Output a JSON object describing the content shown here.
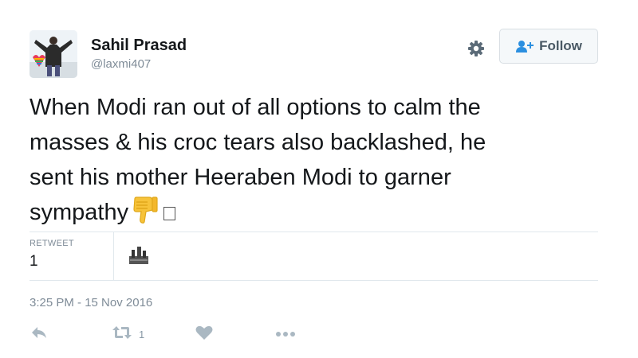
{
  "user": {
    "display_name": "Sahil Prasad",
    "handle": "@laxmi407"
  },
  "header": {
    "follow_label": "Follow"
  },
  "tweet": {
    "text_lines": [
      "When Modi ran out of all options to calm the",
      "masses & his croc tears also backlashed, he",
      "sent his mother Heeraben Modi to garner",
      "sympathy"
    ],
    "emoji": "thumbs-down-icon"
  },
  "stats": {
    "retweet_label": "RETWEET",
    "retweet_count": "1"
  },
  "timestamp": "3:25 PM - 15 Nov 2016",
  "actions": {
    "retweet_count": "1"
  },
  "colors": {
    "text": "#14171a",
    "muted": "#7f8c98",
    "icon": "#aab8c2",
    "border": "#e1e8ed"
  }
}
